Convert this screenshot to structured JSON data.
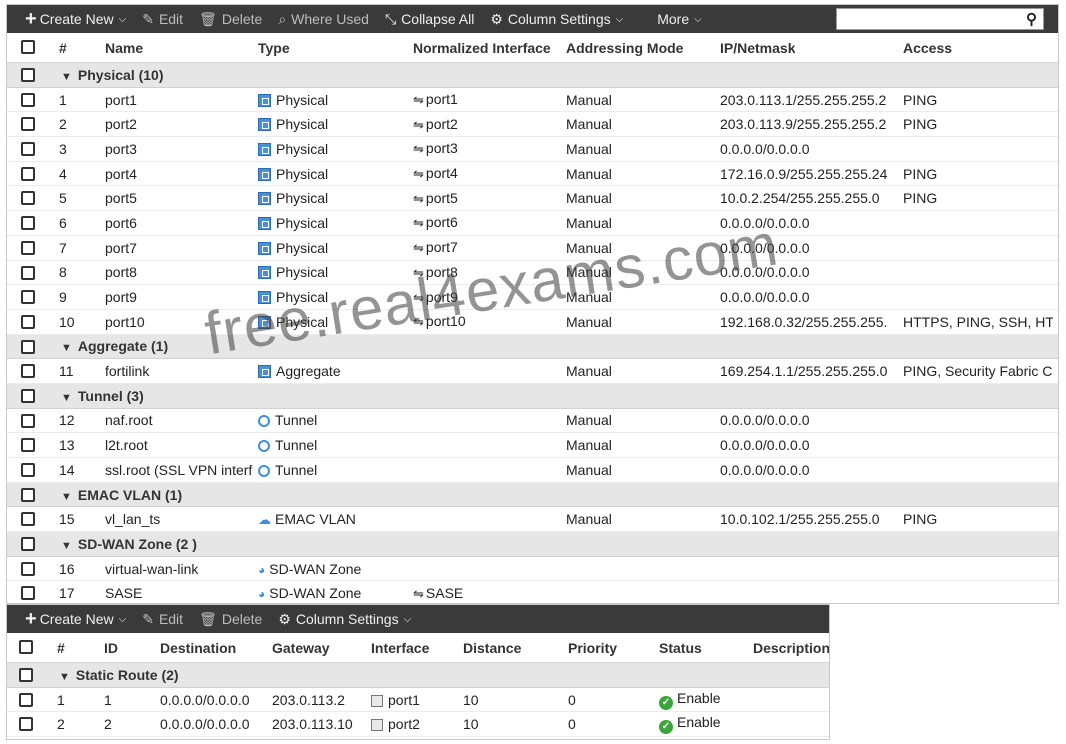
{
  "interfaces": {
    "toolbar": {
      "create_new": "Create New",
      "edit": "Edit",
      "delete": "Delete",
      "where_used": "Where Used",
      "collapse_all": "Collapse All",
      "column_settings": "Column Settings",
      "more": "More",
      "search_value": ""
    },
    "headers": {
      "num": "#",
      "name": "Name",
      "type": "Type",
      "normalized": "Normalized Interface",
      "addressing": "Addressing Mode",
      "ip": "IP/Netmask",
      "access": "Access"
    },
    "rows": [
      {
        "kind": "group",
        "label": "Physical (10)"
      },
      {
        "kind": "item",
        "num": "1",
        "name": "port1",
        "type": "Physical",
        "type_icon": "physical-icon",
        "normalized": "port1",
        "addressing": "Manual",
        "ip": "203.0.113.1/255.255.255.2",
        "access": "PING"
      },
      {
        "kind": "item",
        "num": "2",
        "name": "port2",
        "type": "Physical",
        "type_icon": "physical-icon",
        "normalized": "port2",
        "addressing": "Manual",
        "ip": "203.0.113.9/255.255.255.2",
        "access": "PING"
      },
      {
        "kind": "item",
        "num": "3",
        "name": "port3",
        "type": "Physical",
        "type_icon": "physical-icon",
        "normalized": "port3",
        "addressing": "Manual",
        "ip": "0.0.0.0/0.0.0.0",
        "access": ""
      },
      {
        "kind": "item",
        "num": "4",
        "name": "port4",
        "type": "Physical",
        "type_icon": "physical-icon",
        "normalized": "port4",
        "addressing": "Manual",
        "ip": "172.16.0.9/255.255.255.24",
        "access": "PING"
      },
      {
        "kind": "item",
        "num": "5",
        "name": "port5",
        "type": "Physical",
        "type_icon": "physical-icon",
        "normalized": "port5",
        "addressing": "Manual",
        "ip": "10.0.2.254/255.255.255.0",
        "access": "PING"
      },
      {
        "kind": "item",
        "num": "6",
        "name": "port6",
        "type": "Physical",
        "type_icon": "physical-icon",
        "normalized": "port6",
        "addressing": "Manual",
        "ip": "0.0.0.0/0.0.0.0",
        "access": ""
      },
      {
        "kind": "item",
        "num": "7",
        "name": "port7",
        "type": "Physical",
        "type_icon": "physical-icon",
        "normalized": "port7",
        "addressing": "Manual",
        "ip": "0.0.0.0/0.0.0.0",
        "access": ""
      },
      {
        "kind": "item",
        "num": "8",
        "name": "port8",
        "type": "Physical",
        "type_icon": "physical-icon",
        "normalized": "port8",
        "addressing": "Manual",
        "ip": "0.0.0.0/0.0.0.0",
        "access": ""
      },
      {
        "kind": "item",
        "num": "9",
        "name": "port9",
        "type": "Physical",
        "type_icon": "physical-icon",
        "normalized": "port9",
        "addressing": "Manual",
        "ip": "0.0.0.0/0.0.0.0",
        "access": ""
      },
      {
        "kind": "item",
        "num": "10",
        "name": "port10",
        "type": "Physical",
        "type_icon": "physical-icon",
        "normalized": "port10",
        "addressing": "Manual",
        "ip": "192.168.0.32/255.255.255.",
        "access": "HTTPS, PING, SSH, HT"
      },
      {
        "kind": "group",
        "label": "Aggregate (1)"
      },
      {
        "kind": "item",
        "num": "11",
        "name": "fortilink",
        "type": "Aggregate",
        "type_icon": "aggregate-icon",
        "normalized": "",
        "addressing": "Manual",
        "ip": "169.254.1.1/255.255.255.0",
        "access": "PING, Security Fabric C"
      },
      {
        "kind": "group",
        "label": "Tunnel (3)"
      },
      {
        "kind": "item",
        "num": "12",
        "name": "naf.root",
        "type": "Tunnel",
        "type_icon": "tunnel-icon",
        "normalized": "",
        "addressing": "Manual",
        "ip": "0.0.0.0/0.0.0.0",
        "access": ""
      },
      {
        "kind": "item",
        "num": "13",
        "name": "l2t.root",
        "type": "Tunnel",
        "type_icon": "tunnel-icon",
        "normalized": "",
        "addressing": "Manual",
        "ip": "0.0.0.0/0.0.0.0",
        "access": ""
      },
      {
        "kind": "item",
        "num": "14",
        "name": "ssl.root (SSL VPN interf",
        "type": "Tunnel",
        "type_icon": "tunnel-icon",
        "normalized": "",
        "addressing": "Manual",
        "ip": "0.0.0.0/0.0.0.0",
        "access": ""
      },
      {
        "kind": "group",
        "label": "EMAC VLAN (1)"
      },
      {
        "kind": "item",
        "num": "15",
        "name": "vl_lan_ts",
        "type": "EMAC VLAN",
        "type_icon": "cloud-icon",
        "normalized": "",
        "addressing": "Manual",
        "ip": "10.0.102.1/255.255.255.0",
        "access": "PING"
      },
      {
        "kind": "group",
        "label": "SD-WAN Zone (2 )"
      },
      {
        "kind": "item",
        "num": "16",
        "name": "virtual-wan-link",
        "type": "SD-WAN Zone",
        "type_icon": "sdwan-icon",
        "normalized": "",
        "addressing": "",
        "ip": "",
        "access": ""
      },
      {
        "kind": "item",
        "num": "17",
        "name": "SASE",
        "type": "SD-WAN Zone",
        "type_icon": "sdwan-icon",
        "normalized": "SASE",
        "addressing": "",
        "ip": "",
        "access": ""
      }
    ]
  },
  "routes": {
    "toolbar": {
      "create_new": "Create New",
      "edit": "Edit",
      "delete": "Delete",
      "column_settings": "Column Settings"
    },
    "headers": {
      "num": "#",
      "id": "ID",
      "destination": "Destination",
      "gateway": "Gateway",
      "interface": "Interface",
      "distance": "Distance",
      "priority": "Priority",
      "status": "Status",
      "description": "Description"
    },
    "group_label": "Static Route (2)",
    "rows": [
      {
        "num": "1",
        "id": "1",
        "destination": "0.0.0.0/0.0.0.0",
        "gateway": "203.0.113.2",
        "interface": "port1",
        "distance": "10",
        "priority": "0",
        "status": "Enable"
      },
      {
        "num": "2",
        "id": "2",
        "destination": "0.0.0.0/0.0.0.0",
        "gateway": "203.0.113.10",
        "interface": "port2",
        "distance": "10",
        "priority": "0",
        "status": "Enable"
      }
    ]
  },
  "watermark": "free.real4exams.com"
}
